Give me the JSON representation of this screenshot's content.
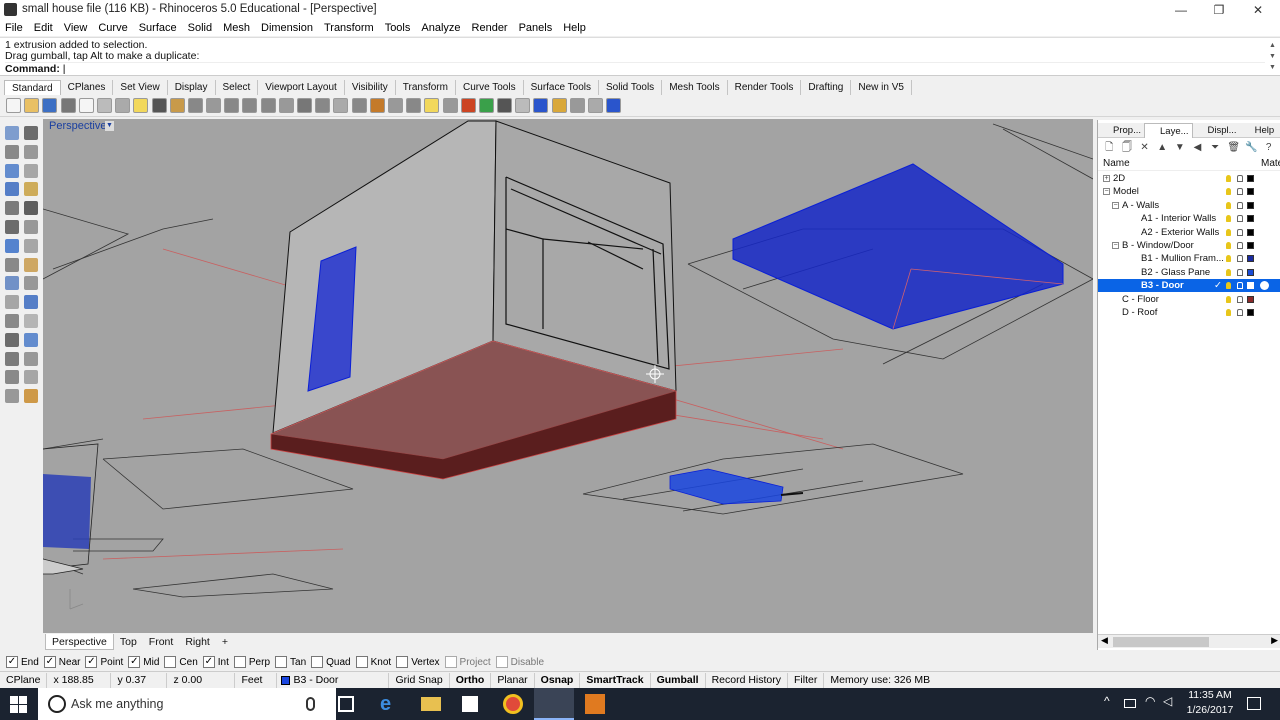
{
  "window": {
    "title": "small house file (116 KB) - Rhinoceros 5.0 Educational - [Perspective]",
    "minimize": "—",
    "maximize": "❐",
    "close": "✕"
  },
  "menu": [
    "File",
    "Edit",
    "View",
    "Curve",
    "Surface",
    "Solid",
    "Mesh",
    "Dimension",
    "Transform",
    "Tools",
    "Analyze",
    "Render",
    "Panels",
    "Help"
  ],
  "command": {
    "line1": "1 extrusion added to selection.",
    "line2": "Drag gumball, tap Alt to make a duplicate:",
    "prompt": "Command:"
  },
  "toolbar_tabs": [
    "Standard",
    "CPlanes",
    "Set View",
    "Display",
    "Select",
    "Viewport Layout",
    "Visibility",
    "Transform",
    "Curve Tools",
    "Surface Tools",
    "Solid Tools",
    "Mesh Tools",
    "Render Tools",
    "Drafting",
    "New in V5"
  ],
  "toolbar_icon_colors": [
    "#f5f5f5",
    "#e9c064",
    "#3c6fc4",
    "#777777",
    "#f5f5f5",
    "#bbbbbb",
    "#aaaaaa",
    "#f2d85c",
    "#555555",
    "#c89a4a",
    "#888888",
    "#999999",
    "#888888",
    "#888888",
    "#888888",
    "#999999",
    "#777777",
    "#888888",
    "#aaaaaa",
    "#888888",
    "#c47a2a",
    "#999999",
    "#888888",
    "#f2d85c",
    "#999999",
    "#cc4422",
    "#3aa04a",
    "#555555",
    "#bbbbbb",
    "#2a55cc",
    "#d9a83a",
    "#999999",
    "#aaaaaa",
    "#2a55cc"
  ],
  "viewport": {
    "label": "Perspective",
    "dropdown": "▼",
    "background": "#a3a3a3",
    "selection_color": "#0a1fd6",
    "floor_color": "#5a1e1e"
  },
  "view_tabs": [
    "Perspective",
    "Top",
    "Front",
    "Right",
    "+"
  ],
  "osnaps": [
    {
      "label": "End",
      "checked": true
    },
    {
      "label": "Near",
      "checked": true
    },
    {
      "label": "Point",
      "checked": true
    },
    {
      "label": "Mid",
      "checked": true
    },
    {
      "label": "Cen",
      "checked": false
    },
    {
      "label": "Int",
      "checked": true
    },
    {
      "label": "Perp",
      "checked": false
    },
    {
      "label": "Tan",
      "checked": false
    },
    {
      "label": "Quad",
      "checked": false
    },
    {
      "label": "Knot",
      "checked": false
    },
    {
      "label": "Vertex",
      "checked": false
    },
    {
      "label": "Project",
      "checked": false,
      "disabled": true
    },
    {
      "label": "Disable",
      "checked": false,
      "disabled": true
    }
  ],
  "status": {
    "cplane": "CPlane",
    "x": "x 188.85",
    "y": "y 0.37",
    "z": "z 0.00",
    "units": "Feet",
    "layer": "B3 - Door",
    "grid_snap": "Grid Snap",
    "ortho": "Ortho",
    "planar": "Planar",
    "osnap": "Osnap",
    "smarttrack": "SmartTrack",
    "gumball": "Gumball",
    "record_history": "Record History",
    "filter": "Filter",
    "memory": "Memory use: 326 MB"
  },
  "panel": {
    "tabs": [
      {
        "label": "Prop...",
        "color": "#5aa0e0"
      },
      {
        "label": "Laye...",
        "color": "#e0a020"
      },
      {
        "label": "Displ...",
        "color": "#666666"
      },
      {
        "label": "Help",
        "color": "#3070d0"
      }
    ],
    "tools": [
      "🗋",
      "🗍",
      "✕",
      "▲",
      "▼",
      "◀",
      "⏷",
      "🗑",
      "🔧",
      "?"
    ],
    "header": {
      "name": "Name",
      "material": "Mate"
    },
    "layers": [
      {
        "name": "2D",
        "level": 0,
        "expander": "+",
        "color": "#000000"
      },
      {
        "name": "Model",
        "level": 0,
        "expander": "−",
        "color": "#000000"
      },
      {
        "name": "A - Walls",
        "level": 1,
        "expander": "−",
        "color": "#000000"
      },
      {
        "name": "A1 - Interior Walls",
        "level": 2,
        "expander": "",
        "color": "#000000"
      },
      {
        "name": "A2 - Exterior Walls",
        "level": 2,
        "expander": "",
        "color": "#000000"
      },
      {
        "name": "B - Window/Door",
        "level": 1,
        "expander": "−",
        "color": "#000000"
      },
      {
        "name": "B1 - Mullion Fram...",
        "level": 2,
        "expander": "",
        "color": "#1a2ba0"
      },
      {
        "name": "B2 - Glass Pane",
        "level": 2,
        "expander": "",
        "color": "#1a4cd6"
      },
      {
        "name": "B3 - Door",
        "level": 2,
        "expander": "",
        "color": "#ffffff",
        "selected": true,
        "current_mark": "✓"
      },
      {
        "name": "C - Floor",
        "level": 1,
        "expander": "",
        "color": "#8a2a2a"
      },
      {
        "name": "D - Roof",
        "level": 1,
        "expander": "",
        "color": "#000000"
      }
    ]
  },
  "taskbar": {
    "search_placeholder": "Ask me anything",
    "time": "11:35 AM",
    "date": "1/26/2017"
  }
}
